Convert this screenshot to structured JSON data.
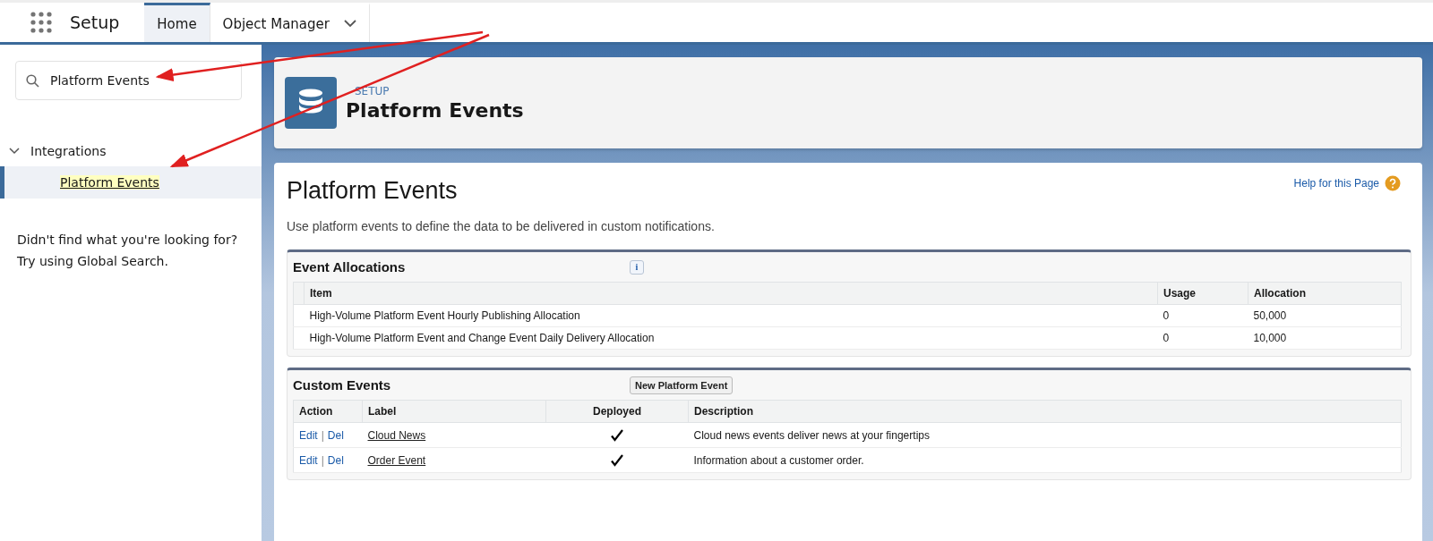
{
  "app_header": {
    "app_name": "Setup",
    "tabs": [
      {
        "label": "Home",
        "selected": true,
        "dropdown": false
      },
      {
        "label": "Object Manager",
        "selected": false,
        "dropdown": true
      }
    ]
  },
  "sidebar": {
    "search": {
      "value": "Platform Events"
    },
    "tree": [
      {
        "label": "Integrations",
        "expanded": true,
        "selected": false,
        "children": [
          {
            "label": "Platform Events",
            "selected": true,
            "match": true
          }
        ]
      }
    ],
    "not_found": [
      "Didn't find what you're looking for?",
      "Try using Global Search."
    ]
  },
  "page_header": {
    "eyebrow": "SETUP",
    "title": "Platform Events"
  },
  "content": {
    "title": "Platform Events",
    "help_link": "Help for this Page",
    "description": "Use platform events to define the data to be delivered in custom notifications.",
    "event_allocations": {
      "title": "Event Allocations",
      "info_icon": "i",
      "columns": [
        "Item",
        "Usage",
        "Allocation"
      ],
      "rows": [
        [
          "High-Volume Platform Event Hourly Publishing Allocation",
          "0",
          "50,000"
        ],
        [
          "High-Volume Platform Event and Change Event Daily Delivery Allocation",
          "0",
          "10,000"
        ]
      ]
    },
    "custom_events": {
      "title": "Custom Events",
      "button": "New Platform Event",
      "columns": [
        "Action",
        "Label",
        "Deployed",
        "Description"
      ],
      "rows": [
        {
          "actions": [
            "Edit",
            "Del"
          ],
          "separator": "|",
          "label": "Cloud News",
          "deployed": true,
          "description": "Cloud news events deliver news at your fingertips"
        },
        {
          "actions": [
            "Edit",
            "Del"
          ],
          "separator": "|",
          "label": "Order Event",
          "deployed": true,
          "description": "Information about a customer order."
        }
      ]
    }
  }
}
